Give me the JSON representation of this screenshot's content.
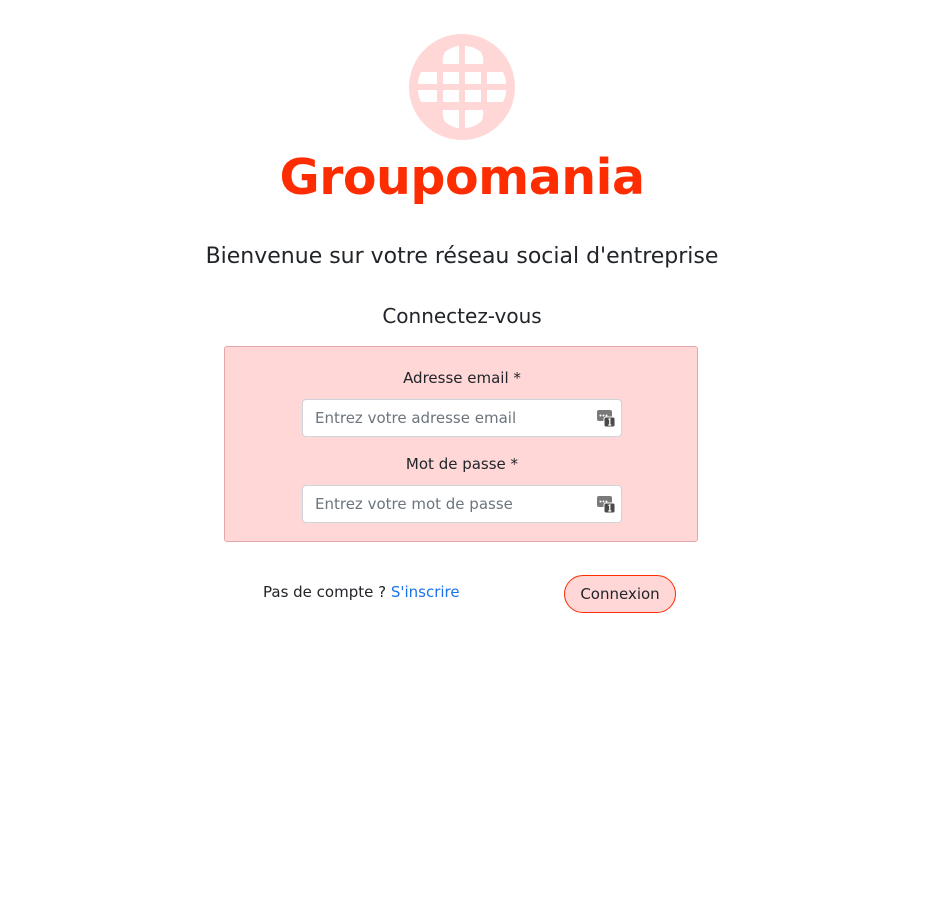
{
  "brand": {
    "name": "Groupomania",
    "color": "#fd2d01",
    "icon_color": "#ffd7d7",
    "logo_icon": "globe-icon"
  },
  "header": {
    "welcome": "Bienvenue sur votre réseau social d'entreprise",
    "subtitle": "Connectez-vous"
  },
  "form": {
    "background": "#ffd7d7",
    "email": {
      "label": "Adresse email *",
      "placeholder": "Entrez votre adresse email",
      "value": "",
      "icon": "password-manager-key-icon"
    },
    "password": {
      "label": "Mot de passe *",
      "placeholder": "Entrez votre mot de passe",
      "value": "",
      "icon": "password-manager-key-icon"
    }
  },
  "footer": {
    "no_account_text": "Pas de compte ? ",
    "signup_link": "S'inscrire",
    "link_color": "#1a73e8",
    "login_button": "Connexion"
  }
}
